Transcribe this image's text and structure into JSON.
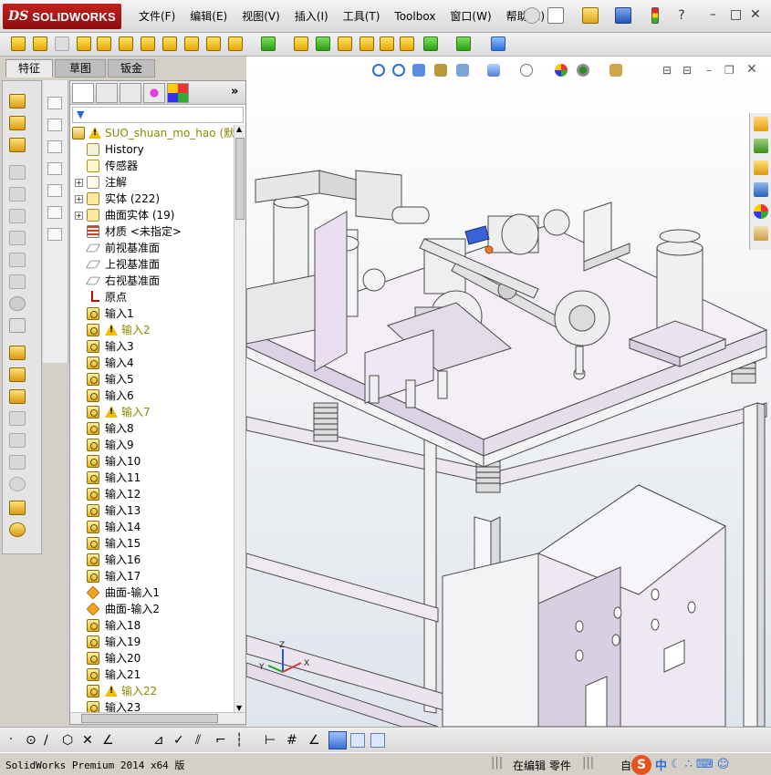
{
  "app": {
    "logo_ds": "DS",
    "logo_name": "SOLIDWORKS"
  },
  "menu": [
    {
      "label": "文件(F)"
    },
    {
      "label": "编辑(E)"
    },
    {
      "label": "视图(V)"
    },
    {
      "label": "插入(I)"
    },
    {
      "label": "工具(T)"
    },
    {
      "label": "Toolbox"
    },
    {
      "label": "窗口(W)"
    },
    {
      "label": "帮助(H)"
    }
  ],
  "tabs": [
    {
      "label": "特征"
    },
    {
      "label": "草图"
    },
    {
      "label": "钣金"
    }
  ],
  "tree": {
    "root_name": "SUO_shuan_mo_hao",
    "root_config": "(默认",
    "items": [
      {
        "label": "History",
        "icon": "history-icon",
        "expand": ""
      },
      {
        "label": "传感器",
        "icon": "sensor-icon",
        "expand": ""
      },
      {
        "label": "注解",
        "icon": "annotations-icon",
        "expand": "+"
      },
      {
        "label": "实体 (222)",
        "icon": "solid-bodies-icon",
        "expand": "+"
      },
      {
        "label": "曲面实体 (19)",
        "icon": "surface-bodies-icon",
        "expand": "+"
      },
      {
        "label": "材质 <未指定>",
        "icon": "material-icon",
        "expand": ""
      },
      {
        "label": "前视基准面",
        "icon": "plane-icon",
        "expand": ""
      },
      {
        "label": "上视基准面",
        "icon": "plane-icon",
        "expand": ""
      },
      {
        "label": "右视基准面",
        "icon": "plane-icon",
        "expand": ""
      },
      {
        "label": "原点",
        "icon": "origin-icon",
        "expand": ""
      },
      {
        "label": "输入1",
        "icon": "import-icon",
        "warn": false
      },
      {
        "label": "输入2",
        "icon": "import-icon",
        "warn": true
      },
      {
        "label": "输入3",
        "icon": "import-icon",
        "warn": false
      },
      {
        "label": "输入4",
        "icon": "import-icon",
        "warn": false
      },
      {
        "label": "输入5",
        "icon": "import-icon",
        "warn": false
      },
      {
        "label": "输入6",
        "icon": "import-icon",
        "warn": false
      },
      {
        "label": "输入7",
        "icon": "import-icon",
        "warn": true
      },
      {
        "label": "输入8",
        "icon": "import-icon",
        "warn": false
      },
      {
        "label": "输入9",
        "icon": "import-icon",
        "warn": false
      },
      {
        "label": "输入10",
        "icon": "import-icon",
        "warn": false
      },
      {
        "label": "输入11",
        "icon": "import-icon",
        "warn": false
      },
      {
        "label": "输入12",
        "icon": "import-icon",
        "warn": false
      },
      {
        "label": "输入13",
        "icon": "import-icon",
        "warn": false
      },
      {
        "label": "输入14",
        "icon": "import-icon",
        "warn": false
      },
      {
        "label": "输入15",
        "icon": "import-icon",
        "warn": false
      },
      {
        "label": "输入16",
        "icon": "import-icon",
        "warn": false
      },
      {
        "label": "输入17",
        "icon": "import-icon",
        "warn": false
      },
      {
        "label": "曲面-输入1",
        "icon": "surface-import-icon",
        "warn": false
      },
      {
        "label": "曲面-输入2",
        "icon": "surface-import-icon",
        "warn": false
      },
      {
        "label": "输入18",
        "icon": "import-icon",
        "warn": false
      },
      {
        "label": "输入19",
        "icon": "import-icon",
        "warn": false
      },
      {
        "label": "输入20",
        "icon": "import-icon",
        "warn": false
      },
      {
        "label": "输入21",
        "icon": "import-icon",
        "warn": false
      },
      {
        "label": "输入22",
        "icon": "import-icon",
        "warn": true
      },
      {
        "label": "输入23",
        "icon": "import-icon",
        "warn": false
      }
    ]
  },
  "triad": {
    "x": "X",
    "y": "Y",
    "z": "Z"
  },
  "status": {
    "product": "SolidWorks Premium 2014 x64 版",
    "mode": "在编辑 零件",
    "ime_label": "自",
    "ime_logo": "S",
    "ime_lang": "中"
  },
  "colors": {
    "brand_red": "#b31919",
    "plate": "#efe8f2",
    "frame_edge": "#6c6c6c",
    "warning": "#f0c000"
  }
}
